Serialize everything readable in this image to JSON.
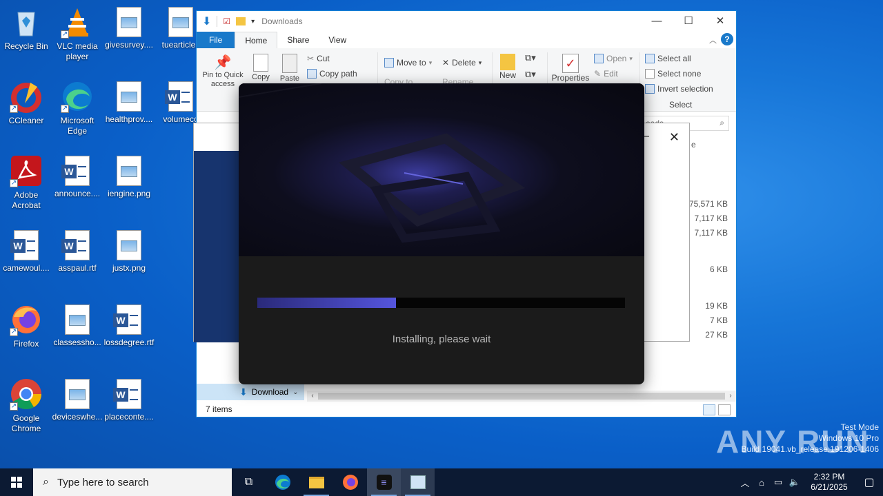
{
  "desktop": {
    "icons": [
      {
        "label": "Recycle Bin",
        "icon": "recycle-bin-icon"
      },
      {
        "label": "VLC media player",
        "icon": "vlc-icon"
      },
      {
        "label": "givesurvey....",
        "icon": "image-file-icon"
      },
      {
        "label": "tuearticle.j",
        "icon": "image-file-icon"
      },
      {
        "label": "CCleaner",
        "icon": "ccleaner-icon"
      },
      {
        "label": "Microsoft Edge",
        "icon": "edge-icon"
      },
      {
        "label": "healthprov....",
        "icon": "image-file-icon"
      },
      {
        "label": "volumeco",
        "icon": "word-doc-icon"
      },
      {
        "label": "Adobe Acrobat",
        "icon": "acrobat-icon"
      },
      {
        "label": "announce....",
        "icon": "word-doc-icon"
      },
      {
        "label": "iengine.png",
        "icon": "image-file-icon"
      },
      {
        "label": "camewoul....",
        "icon": "word-doc-icon"
      },
      {
        "label": "asspaul.rtf",
        "icon": "word-doc-icon"
      },
      {
        "label": "justx.png",
        "icon": "image-file-icon"
      },
      {
        "label": "Firefox",
        "icon": "firefox-icon"
      },
      {
        "label": "classessho...",
        "icon": "image-file-icon"
      },
      {
        "label": "lossdegree.rtf",
        "icon": "word-doc-icon"
      },
      {
        "label": "Google Chrome",
        "icon": "chrome-icon"
      },
      {
        "label": "deviceswhe...",
        "icon": "image-file-icon"
      },
      {
        "label": "placeconte....",
        "icon": "word-doc-icon"
      }
    ]
  },
  "explorer": {
    "title": "Downloads",
    "tabs": [
      "File",
      "Home",
      "Share",
      "View"
    ],
    "ribbon": {
      "pin": "Pin to Quick access",
      "copy": "Copy",
      "paste": "Paste",
      "cut": "Cut",
      "copy_path": "Copy path",
      "move_to": "Move to",
      "copy_to": "Copy to",
      "delete": "Delete",
      "rename": "Rename",
      "new": "New",
      "properties": "Properties",
      "open": "Open",
      "edit": "Edit",
      "select_all": "Select all",
      "select_none": "Select none",
      "invert_selection": "Invert selection",
      "select_group": "Select"
    },
    "search_fragment": "oads",
    "column_fragment": "e",
    "sizes": [
      "75,571 KB",
      "7,117 KB",
      "7,117 KB",
      "6 KB",
      "19 KB",
      "7 KB",
      "27 KB"
    ],
    "nav_selected": "Download",
    "status": "7 items"
  },
  "installer": {
    "status": "Installing, please wait",
    "progress_fraction": 0.377
  },
  "watermark": {
    "brand": "ANY RUN",
    "line1": "Test Mode",
    "line2": "Windows 10 Pro",
    "line3": "Build 19041.vb_release.191206-1406"
  },
  "taskbar": {
    "search_placeholder": "Type here to search",
    "time": "2:32 PM",
    "date": "6/21/2025"
  },
  "colors": {
    "accent": "#1979ca",
    "installer_progress": "#5555dd",
    "taskbar": "#0c1a33"
  }
}
